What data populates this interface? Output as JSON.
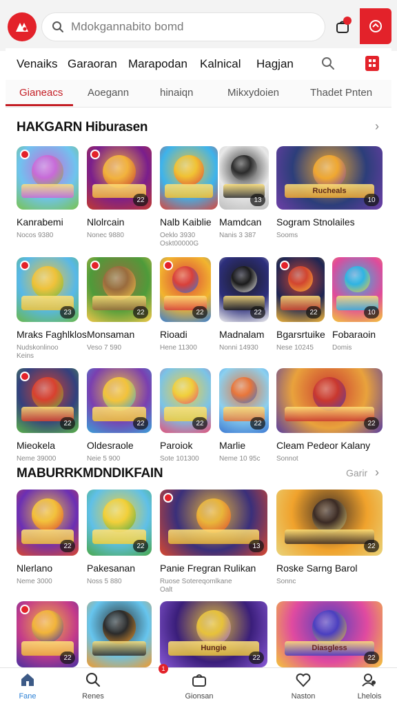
{
  "search": {
    "placeholder": "Mdokgannabito bomd"
  },
  "categories": [
    "Venaiks",
    "Garaoran",
    "Marapodan",
    "Kalnical",
    "Hagjan"
  ],
  "tabs": [
    {
      "label": "Gianeacs",
      "active": true
    },
    {
      "label": "Aoegann",
      "active": false
    },
    {
      "label": "hinaiqn",
      "active": false
    },
    {
      "label": "Mikxydoien",
      "active": false
    },
    {
      "label": "Thadet Pnten",
      "active": false
    }
  ],
  "section1": {
    "title": "HAKGARN Hiburasen"
  },
  "section2": {
    "title": "MABURRKMDNDIKFAIN",
    "more_label": "Garir"
  },
  "tiles": [
    {
      "name": "Kanrabemi",
      "sub": "Nocos 9380",
      "rating": "",
      "badge": true,
      "colors": [
        "#6fc3ef",
        "#c86ad8",
        "#79c350"
      ]
    },
    {
      "name": "Nlolrcain",
      "sub": "Nonec 9880",
      "rating": "22",
      "badge": true,
      "colors": [
        "#7a1e8c",
        "#f2b33d",
        "#c23a2f"
      ]
    },
    {
      "name": "Nalb Kaiblie",
      "sub": "Oeklo 3930",
      "sub2": "Oskt00000G",
      "rating": "",
      "badge": false,
      "colors": [
        "#3db3ec",
        "#f1c233",
        "#d8473d"
      ]
    },
    {
      "name": "Mamdcan",
      "sub": "Nanis 3 387",
      "rating": "13",
      "badge": false,
      "colors": [
        "#e8e8e8",
        "#2b2b2b",
        "#bdbdbd"
      ]
    },
    {
      "name": "Sogram Stnolailes",
      "sub": "Sooms",
      "rating": "10",
      "badge": false,
      "colors": [
        "#2c3e7a",
        "#f0a830",
        "#6e3fa7"
      ]
    },
    {
      "name": "Mraks Faghlklos",
      "sub": "Nudskonlinoo",
      "sub2": "Keins",
      "rating": "23",
      "badge": true,
      "colors": [
        "#57b8e8",
        "#f0c23a",
        "#6ab84a"
      ]
    },
    {
      "name": "Monsaman",
      "sub": "Veso 7 590",
      "rating": "22",
      "badge": true,
      "colors": [
        "#4e9b3a",
        "#9a6b3d",
        "#f2c84a"
      ]
    },
    {
      "name": "Rioadi",
      "sub": "Hene 11300",
      "rating": "22",
      "badge": true,
      "colors": [
        "#f2b52e",
        "#d9403a",
        "#3a7fd0"
      ]
    },
    {
      "name": "Madnalam",
      "sub": "Nonni 14930",
      "rating": "22",
      "badge": false,
      "colors": [
        "#2d2f7c",
        "#1b1b1b",
        "#f0f0f0"
      ]
    },
    {
      "name": "Bgarsrtuike",
      "sub": "Nese 10245",
      "rating": "22",
      "badge": true,
      "colors": [
        "#1d2553",
        "#d2452f",
        "#f2b63a"
      ]
    },
    {
      "name": "Fobaraoin",
      "sub": "Domis",
      "rating": "10",
      "badge": false,
      "colors": [
        "#e04a9a",
        "#2fb4e3",
        "#f3c63c"
      ]
    },
    {
      "name": "Mieokela",
      "sub": "Neme 39000",
      "rating": "22",
      "badge": true,
      "colors": [
        "#33407e",
        "#d9402e",
        "#5bb34a"
      ]
    },
    {
      "name": "Oldesraole",
      "sub": "Neie 5 900",
      "rating": "22",
      "badge": false,
      "colors": [
        "#7a3fb0",
        "#f3c33a",
        "#3aa1d8"
      ]
    },
    {
      "name": "Paroiok",
      "sub": "Sote 101300",
      "rating": "22",
      "badge": false,
      "colors": [
        "#7ac3e8",
        "#f0cf3b",
        "#e2527a"
      ]
    },
    {
      "name": "Marlie",
      "sub": "Neme 10 95c",
      "rating": "22",
      "badge": false,
      "colors": [
        "#8bd0f0",
        "#e8763a",
        "#3e7ad2"
      ]
    },
    {
      "name": "Cleam Pedeor Kalany",
      "sub": "Sonnot",
      "rating": "22",
      "badge": false,
      "colors": [
        "#e9a23c",
        "#c9382f",
        "#5a3fa0"
      ]
    },
    {
      "name": "Nlerlano",
      "sub": "Neme 3000",
      "rating": "22",
      "badge": false,
      "colors": [
        "#6b2fb4",
        "#f3c23c",
        "#d8472f"
      ]
    },
    {
      "name": "Pakesanan",
      "sub": "Noss 5 880",
      "rating": "22",
      "badge": false,
      "colors": [
        "#5fc0e8",
        "#f3d03a",
        "#4aa84a"
      ]
    },
    {
      "name": "Panie Fregran Rulikan",
      "sub": "Ruose Sotereqomlkane",
      "sub2": "Oalt",
      "rating": "13",
      "badge": true,
      "colors": [
        "#3a2f7a",
        "#e9b53a",
        "#d9482f"
      ]
    },
    {
      "name": "Roske Sarng Barol",
      "sub": "Sonnc",
      "rating": "22",
      "badge": false,
      "colors": [
        "#f0a22c",
        "#3a2a24",
        "#e9d37a"
      ]
    },
    {
      "name": "",
      "sub": "",
      "rating": "22",
      "badge": true,
      "colors": [
        "#c43b8a",
        "#f2b53a",
        "#4a2fa0"
      ]
    },
    {
      "name": "",
      "sub": "",
      "rating": "",
      "badge": false,
      "colors": [
        "#66c5ee",
        "#2b2b2b",
        "#f09a2c"
      ]
    },
    {
      "name": "",
      "sub": "",
      "rating": "22",
      "badge": false,
      "colors": [
        "#3a1e7a",
        "#e7c23a",
        "#8a5ad8"
      ]
    },
    {
      "name": "",
      "sub": "",
      "rating": "22",
      "badge": false,
      "colors": [
        "#e04aa0",
        "#4a3fc0",
        "#f3c43a"
      ]
    }
  ],
  "tile_wordart": [
    "",
    "",
    "",
    "",
    "Rucheals",
    "",
    "",
    "",
    "",
    "",
    "",
    "",
    "",
    "",
    "",
    "",
    "",
    "",
    "",
    "",
    "",
    "",
    "Hungie",
    "Diasgless"
  ],
  "bottom_nav": [
    {
      "label": "Fane",
      "icon": "home-icon",
      "active": true
    },
    {
      "label": "Renes",
      "icon": "search-icon",
      "active": false
    },
    {
      "label": "Gionsan",
      "icon": "bag-icon",
      "active": false,
      "badge": "1"
    },
    {
      "label": "Naston",
      "icon": "heart-icon",
      "active": false
    },
    {
      "label": "Lhelois",
      "icon": "account-icon",
      "active": false
    }
  ],
  "colors": {
    "brand": "#e3222a",
    "tab_active": "#c41e25",
    "nav_active": "#2a7fd4"
  }
}
